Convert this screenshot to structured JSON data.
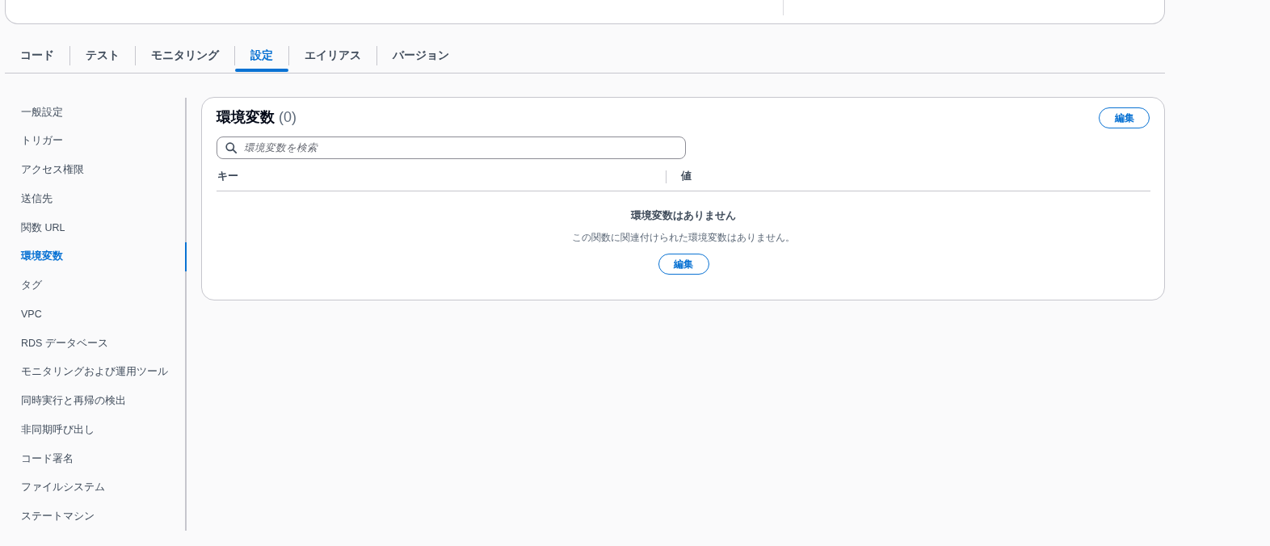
{
  "tabs": [
    {
      "label": "コード",
      "selected": false
    },
    {
      "label": "テスト",
      "selected": false
    },
    {
      "label": "モニタリング",
      "selected": false
    },
    {
      "label": "設定",
      "selected": true
    },
    {
      "label": "エイリアス",
      "selected": false
    },
    {
      "label": "バージョン",
      "selected": false
    }
  ],
  "sidebar": {
    "items": [
      {
        "label": "一般設定",
        "selected": false
      },
      {
        "label": "トリガー",
        "selected": false
      },
      {
        "label": "アクセス権限",
        "selected": false
      },
      {
        "label": "送信先",
        "selected": false
      },
      {
        "label": "関数 URL",
        "selected": false
      },
      {
        "label": "環境変数",
        "selected": true
      },
      {
        "label": "タグ",
        "selected": false
      },
      {
        "label": "VPC",
        "selected": false
      },
      {
        "label": "RDS データベース",
        "selected": false
      },
      {
        "label": "モニタリングおよび運用ツール",
        "selected": false
      },
      {
        "label": "同時実行と再帰の検出",
        "selected": false
      },
      {
        "label": "非同期呼び出し",
        "selected": false
      },
      {
        "label": "コード署名",
        "selected": false
      },
      {
        "label": "ファイルシステム",
        "selected": false
      },
      {
        "label": "ステートマシン",
        "selected": false
      }
    ]
  },
  "environment_variables": {
    "title": "環境変数",
    "count": "(0)",
    "edit_button": "編集",
    "search": {
      "placeholder": "環境変数を検索"
    },
    "table": {
      "columns": [
        "キー",
        "値"
      ]
    },
    "empty_state": {
      "title": "環境変数はありません",
      "message": "この関数に関連付けられた環境変数はありません。",
      "button": "編集"
    }
  }
}
